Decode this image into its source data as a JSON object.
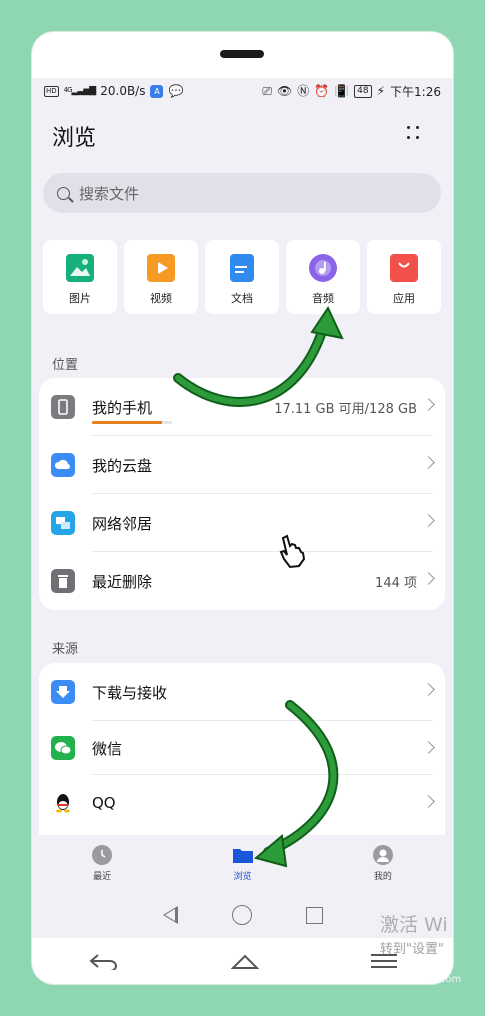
{
  "status_bar": {
    "hd": "HD",
    "network": "4G",
    "speed": "20.0B/s",
    "battery": "48",
    "time": "下午1:26"
  },
  "header": {
    "title": "浏览"
  },
  "search": {
    "placeholder": "搜索文件"
  },
  "categories": [
    {
      "label": "图片",
      "icon": "image-icon",
      "color": "#16b07a"
    },
    {
      "label": "视频",
      "icon": "video-icon",
      "color": "#f59a23"
    },
    {
      "label": "文档",
      "icon": "document-icon",
      "color": "#2f8bf0"
    },
    {
      "label": "音频",
      "icon": "audio-icon",
      "color": "#8a63e6"
    },
    {
      "label": "应用",
      "icon": "app-icon",
      "color": "#f2504b"
    }
  ],
  "location": {
    "section": "位置",
    "items": [
      {
        "name": "我的手机",
        "value": "17.11 GB 可用/128 GB",
        "icon": "phone-icon",
        "color": "#7b7b80",
        "usage_fraction": 0.87
      },
      {
        "name": "我的云盘",
        "value": "",
        "icon": "cloud-icon",
        "color": "#3b8cf5"
      },
      {
        "name": "网络邻居",
        "value": "",
        "icon": "network-icon",
        "color": "#25a5e8"
      },
      {
        "name": "最近删除",
        "value": "144 项",
        "icon": "trash-icon",
        "color": "#6f6f74"
      }
    ]
  },
  "source": {
    "section": "来源",
    "items": [
      {
        "name": "下载与接收",
        "icon": "download-icon",
        "color": "#3b8cf5"
      },
      {
        "name": "微信",
        "icon": "wechat-icon",
        "color": "#22b14c"
      },
      {
        "name": "QQ",
        "icon": "qq-icon",
        "color": "#111111"
      }
    ]
  },
  "tabs": [
    {
      "label": "最近",
      "icon": "clock-icon",
      "active": false
    },
    {
      "label": "浏览",
      "icon": "folder-icon",
      "active": true
    },
    {
      "label": "我的",
      "icon": "person-icon",
      "active": false
    }
  ],
  "watermark": {
    "line1": "激活 Wi",
    "line2": "转到\"设置\"",
    "site": "jingyan.baidu.com"
  },
  "colors": {
    "accent": "#1a56d8",
    "usage_bar": "#e6801f",
    "arrow": "#1e8a2a"
  }
}
